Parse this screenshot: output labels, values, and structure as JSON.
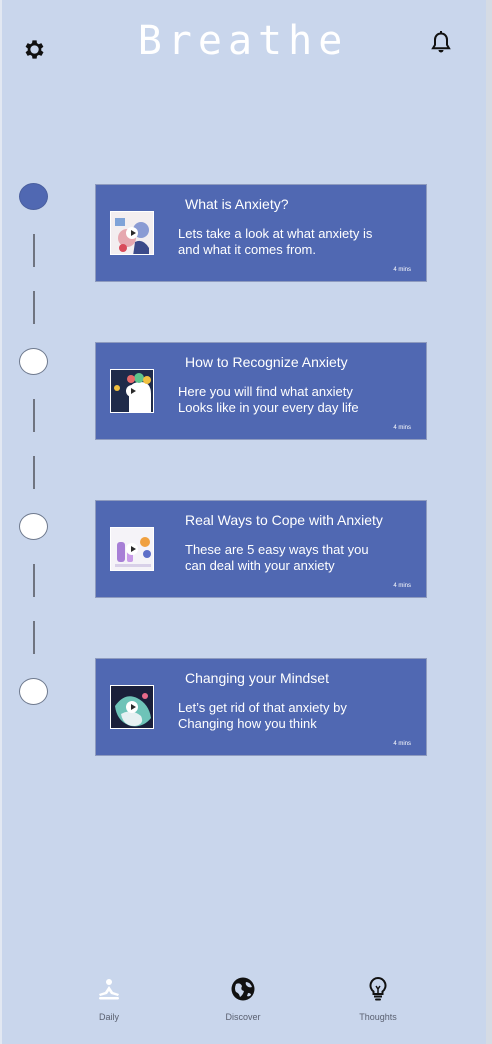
{
  "header": {
    "title": "Breathe",
    "settings_icon": "gear-icon",
    "notifications_icon": "bell-icon"
  },
  "lessons": [
    {
      "title": "What is Anxiety?",
      "description": "Lets take a look at what anxiety is\nand what it comes from.",
      "duration": "4 mins",
      "completed": true
    },
    {
      "title": "How to Recognize Anxiety",
      "description": "Here you will find what anxiety\nLooks like in your every day life",
      "duration": "4 mins",
      "completed": false
    },
    {
      "title": "Real Ways to Cope with Anxiety",
      "description": "These are 5 easy ways that you\ncan deal with your anxiety",
      "duration": "4 mins",
      "completed": false
    },
    {
      "title": "Changing your Mindset",
      "description": "Let’s get rid of that anxiety by\nChanging how you think",
      "duration": "4 mins",
      "completed": false
    }
  ],
  "bottom_nav": [
    {
      "label": "Daily",
      "icon": "meditation-icon"
    },
    {
      "label": "Discover",
      "icon": "globe-icon"
    },
    {
      "label": "Thoughts",
      "icon": "lightbulb-icon"
    }
  ],
  "colors": {
    "background": "#c9d6ec",
    "card": "#5068b2",
    "accent_filled_dot": "#5068b2",
    "text_light": "#ffffff"
  }
}
